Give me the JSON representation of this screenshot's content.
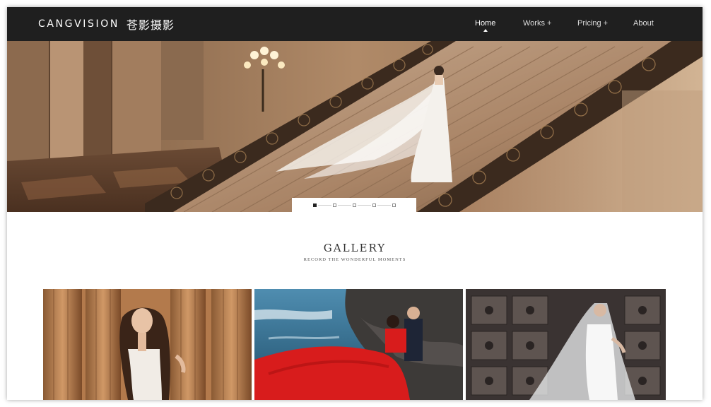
{
  "header": {
    "brand_en": "CANGVISION",
    "brand_cn": "苍影摄影",
    "nav": [
      {
        "label": "Home",
        "active": true
      },
      {
        "label": "Works +",
        "active": false
      },
      {
        "label": "Pricing +",
        "active": false
      },
      {
        "label": "About",
        "active": false
      }
    ]
  },
  "hero": {
    "slide_count": 5,
    "active_slide": 1
  },
  "gallery": {
    "title": "GALLERY",
    "subtitle": "RECORD THE WONDERFUL MOMENTS"
  },
  "colors": {
    "header_bg": "#1f1f1f",
    "hero_tone": "#6b4d35",
    "dress_red": "#d81c1c",
    "sea_blue": "#2f6f93"
  }
}
